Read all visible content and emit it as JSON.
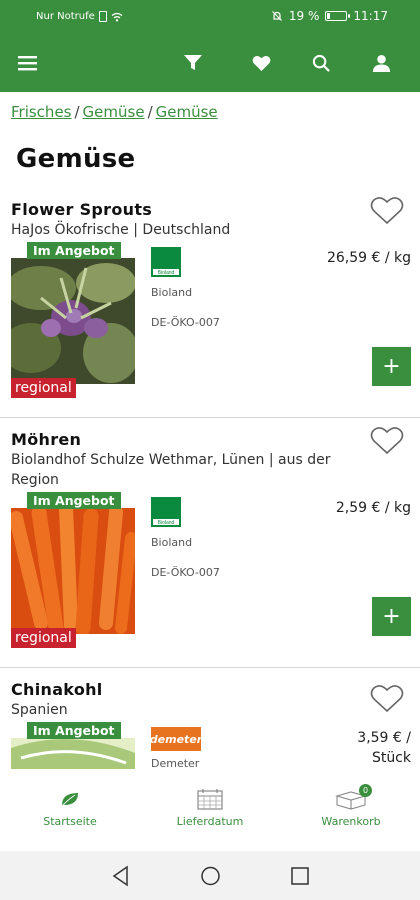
{
  "statusbar": {
    "carrier": "Nur Notrufe",
    "battery": "19 %",
    "time": "11:17"
  },
  "appbar": {
    "icons": [
      "menu-icon",
      "filter-icon",
      "heart-icon",
      "search-icon",
      "account-icon"
    ]
  },
  "breadcrumb": {
    "items": [
      "Frisches",
      "Gemüse",
      "Gemüse"
    ]
  },
  "page": {
    "title": "Gemüse"
  },
  "products": [
    {
      "name": "Flower Sprouts",
      "origin": "HaJos Ökofrische | Deutschland",
      "price": "26,59 € / kg",
      "offer_badge": "Im Angebot",
      "regional_badge": "regional",
      "cert_logo_text": "Bioland",
      "cert_name": "Bioland",
      "cert_code": "DE-ÖKO-007",
      "add_label": "+"
    },
    {
      "name": "Möhren",
      "origin": "Biolandhof Schulze Wethmar, Lünen | aus der Region",
      "price": "2,59 € / kg",
      "offer_badge": "Im Angebot",
      "regional_badge": "regional",
      "cert_logo_text": "Bioland",
      "cert_name": "Bioland",
      "cert_code": "DE-ÖKO-007",
      "add_label": "+"
    },
    {
      "name": "Chinakohl",
      "origin": "Spanien",
      "price": "3,59 € / Stück",
      "offer_badge": "Im Angebot",
      "cert_logo_text": "demeter",
      "cert_name": "Demeter"
    }
  ],
  "bottomnav": {
    "items": [
      {
        "label": "Startseite",
        "icon": "leaf-icon"
      },
      {
        "label": "Lieferdatum",
        "icon": "calendar-icon"
      },
      {
        "label": "Warenkorb",
        "icon": "cart-box-icon",
        "count": "0"
      }
    ]
  },
  "colors": {
    "primary": "#3a8f3e",
    "regional": "#c8222f",
    "demeter": "#e8731f"
  }
}
